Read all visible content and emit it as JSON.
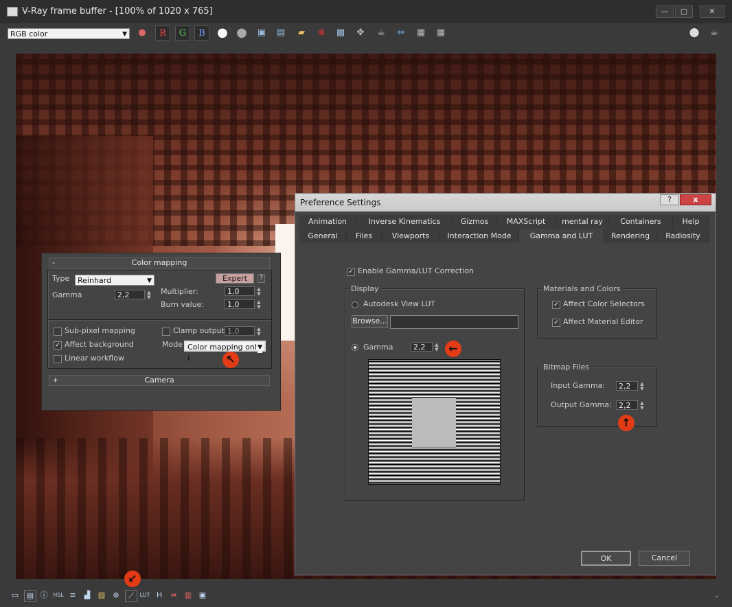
{
  "vfb": {
    "title": "V-Ray frame buffer - [100% of 1020 x 765]",
    "channel": "RGB color",
    "channel_buttons": [
      "R",
      "G",
      "B"
    ],
    "window_buttons": [
      "—",
      "▢",
      "✕"
    ]
  },
  "color_mapping": {
    "header": "Color mapping",
    "collapse": "-",
    "type_label": "Type",
    "type_value": "Reinhard",
    "expert_label": "Expert",
    "help": "?",
    "gamma_label": "Gamma",
    "gamma_value": "2,2",
    "multiplier_label": "Multiplier:",
    "multiplier_value": "1,0",
    "burn_label": "Burn value:",
    "burn_value": "1,0",
    "subpixel_label": "Sub-pixel mapping",
    "clamp_label": "Clamp output",
    "clamp_value": "1,0",
    "affect_bg_label": "Affect background",
    "mode_label": "Mode",
    "mode_value": "Color mapping only (",
    "linear_label": "Linear workflow",
    "camera_expand": "+",
    "camera_header": "Camera"
  },
  "prefs": {
    "title": "Preference Settings",
    "help_btn": "?",
    "close_btn": "x",
    "tabs_row1": [
      "Animation",
      "Inverse Kinematics",
      "Gizmos",
      "MAXScript",
      "mental ray",
      "Containers",
      "Help"
    ],
    "tabs_row2": [
      "General",
      "Files",
      "Viewports",
      "Interaction Mode",
      "Gamma and LUT",
      "Rendering",
      "Radiosity"
    ],
    "enable_label": "Enable Gamma/LUT Correction",
    "display_group": "Display",
    "lut_label": "Autodesk View LUT",
    "browse_label": "Browse...",
    "browse_value": "",
    "gamma_label": "Gamma",
    "gamma_value": "2,2",
    "materials_group": "Materials and Colors",
    "affect_color_label": "Affect Color Selectors",
    "affect_material_label": "Affect Material Editor",
    "bitmap_group": "Bitmap Files",
    "input_gamma_label": "Input Gamma:",
    "input_gamma_value": "2,2",
    "output_gamma_label": "Output Gamma:",
    "output_gamma_value": "2,2",
    "ok_label": "OK",
    "cancel_label": "Cancel"
  },
  "annotations": {
    "arrow_mode": "↖",
    "arrow_gamma": "←",
    "arrow_output": "↑",
    "arrow_status": "↙"
  }
}
